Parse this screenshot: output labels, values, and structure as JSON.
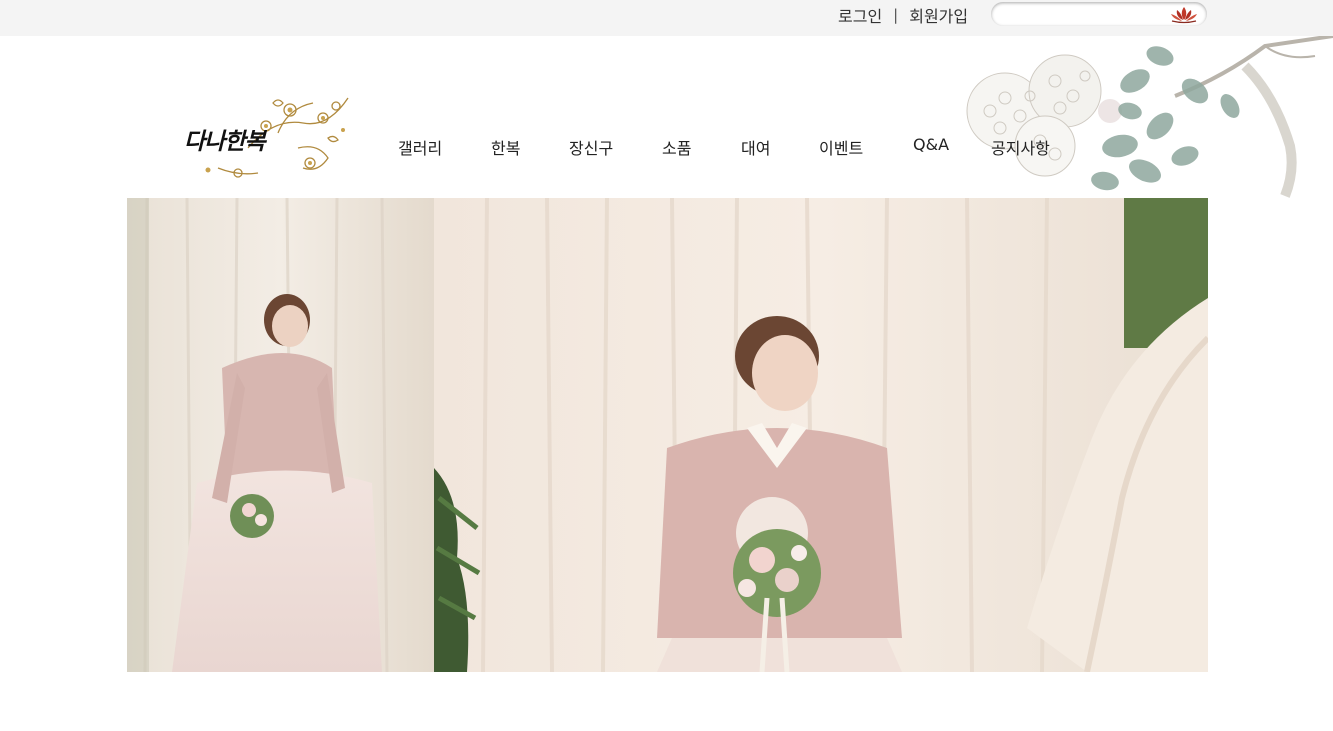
{
  "topbar": {
    "login_label": "로그인",
    "separator": "|",
    "signup_label": "회원가입",
    "search": {
      "value": "",
      "placeholder": "",
      "button_icon": "lotus-icon"
    }
  },
  "header": {
    "logo_text": "다나한복",
    "logo_icon": "floral-ornament-icon"
  },
  "nav": {
    "items": [
      {
        "label": "갤러리"
      },
      {
        "label": "한복"
      },
      {
        "label": "장신구"
      },
      {
        "label": "소품"
      },
      {
        "label": "대여"
      },
      {
        "label": "이벤트"
      },
      {
        "label": "Q&A"
      },
      {
        "label": "공지사항"
      }
    ]
  },
  "colors": {
    "topbar_bg": "#f4f4f4",
    "lotus_red": "#c0392b",
    "hanbok_pink": "#dcb8b4",
    "curtain": "#f2e8de"
  }
}
